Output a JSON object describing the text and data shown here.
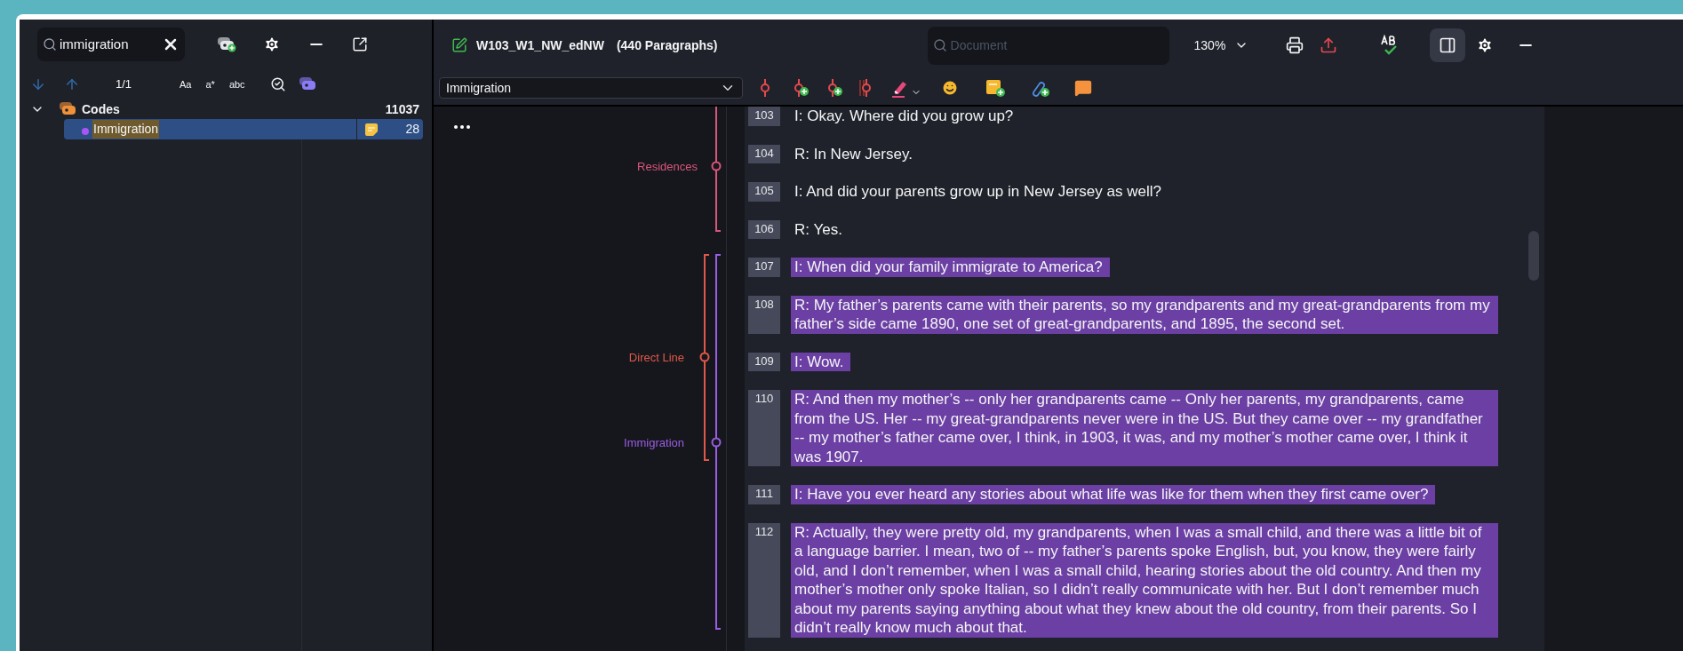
{
  "left_panel": {
    "search": {
      "value": "immigration"
    },
    "match_count": "1/1",
    "search_options": [
      "Aa",
      "a*",
      "abc"
    ],
    "tree": [
      {
        "label": "Codes",
        "count": "11037",
        "expanded": true,
        "children": [
          {
            "label": "Immigration",
            "count": "28",
            "selected": true,
            "search_match": true,
            "color": "#a855f7"
          }
        ]
      }
    ]
  },
  "document": {
    "title": "W103_W1_NW_edNW",
    "paragraph_count": "(440 Paragraphs)",
    "search": {
      "placeholder": "Document"
    },
    "zoom": "130%",
    "side_panel_toggle": {
      "selected": true
    }
  },
  "toolbar": {
    "code_select": "Immigration"
  },
  "margin_codes": [
    {
      "label": "Residences",
      "color": "#d9557a"
    },
    {
      "label": "Direct Line",
      "color": "#e0584a"
    },
    {
      "label": "Immigration",
      "color": "#9b5de5"
    }
  ],
  "paragraphs": [
    {
      "number": "103",
      "text": "I: Okay. Where did you grow up?",
      "highlighted": false
    },
    {
      "number": "104",
      "text": "R: In New Jersey.",
      "highlighted": false
    },
    {
      "number": "105",
      "text": "I: And did your parents grow up in New Jersey as well?",
      "highlighted": false
    },
    {
      "number": "106",
      "text": "R: Yes.",
      "highlighted": false
    },
    {
      "number": "107",
      "text": "I: When did your family immigrate to America?",
      "highlighted": true
    },
    {
      "number": "108",
      "text": "R: My father’s parents came with their parents, so my grandparents and my great-grandparents from my father’s side came 1890, one set of great-grandparents, and 1895, the second set.",
      "highlighted": true
    },
    {
      "number": "109",
      "text": "I: Wow.",
      "highlighted": true
    },
    {
      "number": "110",
      "text": "R: And then my mother’s -- only her grandparents came -- Only her parents, my grandparents, came from the US. Her -- my great-grandparents never were in the US. But they came over -- my grandfather -- my mother’s father came over, I think, in 1903, it was, and my mother’s mother came over, I think it was 1907.",
      "highlighted": true
    },
    {
      "number": "111",
      "text": "I: Have you ever heard any stories about what life was like for them when they first came over?",
      "highlighted": true
    },
    {
      "number": "112",
      "text": "R: Actually, they were pretty old, my grandparents, when I was a small child, and there was a little bit of a language barrier. I mean, two of -- my father’s parents spoke English, but, you know, they were fairly old, and I don’t remember, when I was a small child, hearing stories about the old country. And then my mother’s mother only spoke Italian, so I didn’t really communicate with her. But I don’t remember much about my parents saying anything about what they knew about the old country, from their parents. So I didn’t really know much about that.",
      "highlighted": true
    }
  ]
}
